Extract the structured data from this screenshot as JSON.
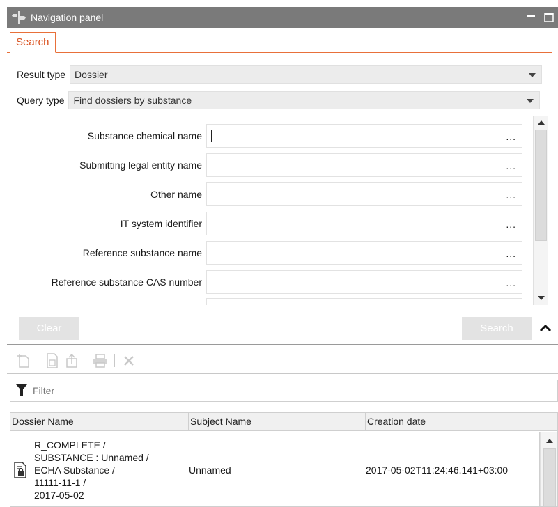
{
  "window": {
    "title": "Navigation panel"
  },
  "tabs": [
    {
      "label": "Search"
    }
  ],
  "search": {
    "result_type": {
      "label": "Result type",
      "value": "Dossier"
    },
    "query_type": {
      "label": "Query type",
      "value": "Find dossiers by substance"
    },
    "fields": [
      {
        "label": "Substance chemical name",
        "value": "",
        "button": "..."
      },
      {
        "label": "Submitting legal entity name",
        "value": "",
        "button": "..."
      },
      {
        "label": "Other name",
        "value": "",
        "button": "..."
      },
      {
        "label": "IT system identifier",
        "value": "",
        "button": "..."
      },
      {
        "label": "Reference substance name",
        "value": "",
        "button": "..."
      },
      {
        "label": "Reference substance CAS number",
        "value": "",
        "button": "..."
      }
    ],
    "clear_label": "Clear",
    "search_label": "Search"
  },
  "results": {
    "filter_placeholder": "Filter",
    "columns": [
      "Dossier Name",
      "Subject Name",
      "Creation date"
    ],
    "rows": [
      {
        "name_lines": [
          "R_COMPLETE /",
          "SUBSTANCE : Unnamed /",
          "ECHA Substance /",
          "11111-11-1 /",
          "2017-05-02"
        ],
        "subject": "Unnamed",
        "date": "2017-05-02T11:24:46.141+03:00"
      }
    ]
  },
  "colors": {
    "accent": "#e8703a",
    "titlebar": "#7a7a7a"
  }
}
